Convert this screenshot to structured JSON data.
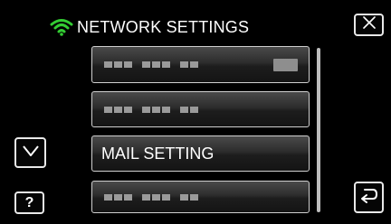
{
  "header": {
    "title": "NETWORK SETTINGS",
    "icon": "wifi-icon",
    "icon_color": "#33cc33"
  },
  "buttons": {
    "close_icon": "close-icon",
    "down_icon": "chevron-down-icon",
    "help_label": "?",
    "back_icon": "return-icon"
  },
  "menu": {
    "items": [
      {
        "label": "",
        "obscured": true,
        "has_tag": true
      },
      {
        "label": "",
        "obscured": true
      },
      {
        "label": "MAIL SETTING",
        "obscured": false
      },
      {
        "label": "",
        "obscured": true
      }
    ]
  }
}
